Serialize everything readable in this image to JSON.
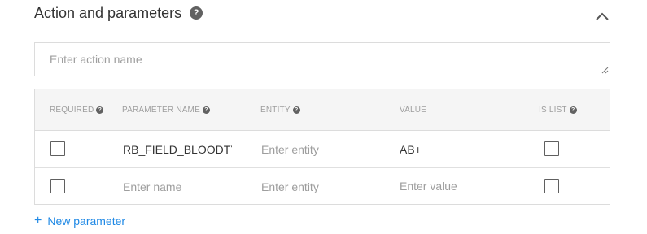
{
  "section": {
    "title": "Action and parameters",
    "help_icon": "?"
  },
  "action": {
    "placeholder": "Enter action name",
    "value": ""
  },
  "table": {
    "columns": [
      {
        "label": "REQUIRED",
        "help": "?"
      },
      {
        "label": "PARAMETER NAME",
        "help": "?"
      },
      {
        "label": "ENTITY",
        "help": "?"
      },
      {
        "label": "VALUE"
      },
      {
        "label": "IS LIST",
        "help": "?"
      }
    ],
    "rows": [
      {
        "required": false,
        "name": "RB_FIELD_BLOODTYPE",
        "name_placeholder": "Enter name",
        "entity": "",
        "entity_placeholder": "Enter entity",
        "value": "AB+",
        "value_placeholder": "Enter value",
        "is_list": false
      },
      {
        "required": false,
        "name": "",
        "name_placeholder": "Enter name",
        "entity": "",
        "entity_placeholder": "Enter entity",
        "value": "",
        "value_placeholder": "Enter value",
        "is_list": false
      }
    ]
  },
  "new_parameter": {
    "icon": "+",
    "label": "New parameter"
  },
  "colors": {
    "link": "#1e88e5",
    "header_bg": "#f5f5f5",
    "border": "#dcdcdc",
    "placeholder": "#9e9e9e"
  },
  "icons": {
    "title_help": "help-circle-icon",
    "collapse": "chevron-up-icon",
    "add": "plus-icon"
  }
}
